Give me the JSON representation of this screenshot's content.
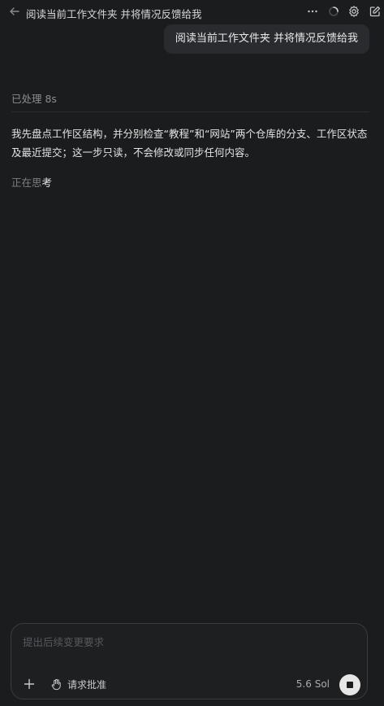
{
  "header": {
    "title": "阅读当前工作文件夹 并将情况反馈给我",
    "icons": [
      "back-icon",
      "more-icon",
      "loading-spinner-icon",
      "settings-gear-icon",
      "edit-icon"
    ]
  },
  "chat": {
    "user_message": "阅读当前工作文件夹 并将情况反馈给我",
    "processed_label": "已处理 8s",
    "assistant_message": "我先盘点工作区结构，并分别检查“教程”和“网站”两个仓库的分支、工作区状态及最近提交；这一步只读，不会修改或同步任何内容。",
    "thinking_dim": "正在思",
    "thinking_bright": "考"
  },
  "composer": {
    "placeholder": "提出后续变更要求",
    "value": "",
    "approve_label": "请求批准",
    "model_label": "5.6 Sol",
    "icons": [
      "plus-icon",
      "hand-icon",
      "stop-icon"
    ]
  },
  "colors": {
    "background": "#1b1c1e",
    "bubble": "#2a2b2e",
    "text": "#e6e6e6",
    "muted": "#8e8e92"
  }
}
